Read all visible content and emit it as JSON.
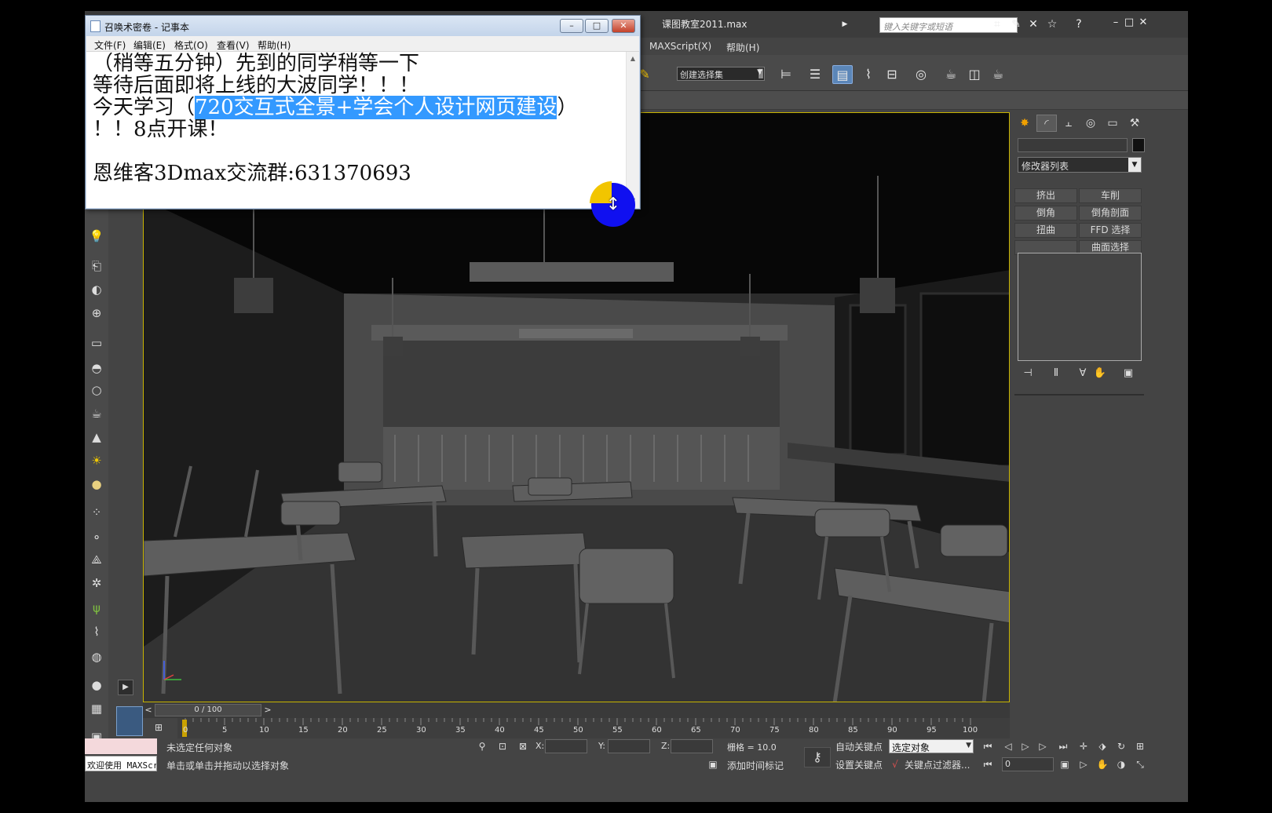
{
  "app": {
    "title": "课图教室2011.max",
    "search_placeholder": "键入关键字或短语",
    "menus": [
      "MAXScript(X)",
      "帮助(H)"
    ],
    "selection_set": "创建选择集"
  },
  "command_panel": {
    "modifier_list": "修改器列表",
    "modifiers": [
      "挤出",
      "车削",
      "倒角",
      "倒角剖面",
      "扭曲",
      "FFD 选择",
      "",
      "曲面选择"
    ]
  },
  "timeline": {
    "slider": "0 / 100",
    "ticks": [
      "0",
      "5",
      "10",
      "15",
      "20",
      "25",
      "30",
      "35",
      "40",
      "45",
      "50",
      "55",
      "60",
      "65",
      "70",
      "75",
      "80",
      "85",
      "90",
      "95",
      "100"
    ]
  },
  "status": {
    "welcome": "欢迎使用 MAXScr",
    "selection": "未选定任何对象",
    "prompt": "单击或单击并拖动以选择对象",
    "x_label": "X:",
    "y_label": "Y:",
    "z_label": "Z:",
    "grid": "栅格 = 10.0",
    "add_time_tag": "添加时间标记",
    "auto_key": "自动关键点",
    "set_key": "设置关键点",
    "selected_filter": "选定对象",
    "key_filters": "关键点过滤器...",
    "frame": "0"
  },
  "notepad": {
    "title": "召唤术密卷 - 记事本",
    "menus": [
      "文件(F)",
      "编辑(E)",
      "格式(O)",
      "查看(V)",
      "帮助(H)"
    ],
    "line1": "（稍等五分钟）先到的同学稍等一下",
    "line2": "等待后面即将上线的大波同学！！！",
    "line3_pre": "今天学习（",
    "line3_sel": "720交互式全景+学会个人设计网页建设",
    "line3_post": "）",
    "line4": "！！8点开课！",
    "line5": "",
    "line6": "恩维客3Dmax交流群:631370693"
  },
  "colors": {
    "selection_highlight": "#3399ff",
    "viewport_border": "#c8b400",
    "cursor_ring": "#1010f0"
  }
}
